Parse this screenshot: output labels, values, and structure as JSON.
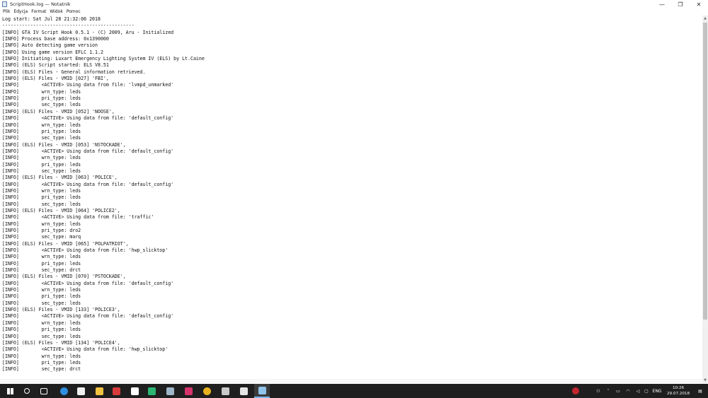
{
  "window": {
    "title": "ScriptHook.log — Notatnik",
    "minimize_glyph": "—",
    "maximize_glyph": "❐",
    "close_glyph": "✕"
  },
  "menu": [
    "Plik",
    "Edycja",
    "Format",
    "Widok",
    "Pomoc"
  ],
  "lines": [
    "Log start: Sat Jul 28 21:32:06 2018",
    "-----------------------------------------------",
    "[INFO] GTA IV Script Hook 0.5.1 - (C) 2009, Aru - Initialized",
    "[INFO] Process base address: 0x1390000",
    "[INFO] Auto detecting game version",
    "[INFO] Using game version EFLC 1.1.2",
    "[INFO] Initiating: Luxart Emergency Lighting System IV (ELS) by Lt.Caine",
    "[INFO] (ELS) Script started: ELS V8.51",
    "[INFO] (ELS) Files - General information retrieved.",
    "[INFO] (ELS) Files - VMID [027] 'FBI',",
    "[INFO]        <ACTIVE> Using data from file: 'lvmpd_unmarked'",
    "[INFO]        wrn_type: leds",
    "[INFO]        pri_type: leds",
    "[INFO]        sec_type: leds",
    "[INFO] (ELS) Files - VMID [052] 'NOOSE',",
    "[INFO]        <ACTIVE> Using data from file: 'default_config'",
    "[INFO]        wrn_type: leds",
    "[INFO]        pri_type: leds",
    "[INFO]        sec_type: leds",
    "[INFO] (ELS) Files - VMID [053] 'NSTOCKADE',",
    "[INFO]        <ACTIVE> Using data from file: 'default_config'",
    "[INFO]        wrn_type: leds",
    "[INFO]        pri_type: leds",
    "[INFO]        sec_type: leds",
    "[INFO] (ELS) Files - VMID [063] 'POLICE',",
    "[INFO]        <ACTIVE> Using data from file: 'default_config'",
    "[INFO]        wrn_type: leds",
    "[INFO]        pri_type: leds",
    "[INFO]        sec_type: leds",
    "[INFO] (ELS) Files - VMID [064] 'POLICE2',",
    "[INFO]        <ACTIVE> Using data from file: 'traffic'",
    "[INFO]        wrn_type: leds",
    "[INFO]        pri_type: dro2",
    "[INFO]        sec_type: marq",
    "[INFO] (ELS) Files - VMID [065] 'POLPATRIOT',",
    "[INFO]        <ACTIVE> Using data from file: 'hwp_slicktop'",
    "[INFO]        wrn_type: leds",
    "[INFO]        pri_type: leds",
    "[INFO]        sec_type: drct",
    "[INFO] (ELS) Files - VMID [070] 'PSTOCKADE',",
    "[INFO]        <ACTIVE> Using data from file: 'default_config'",
    "[INFO]        wrn_type: leds",
    "[INFO]        pri_type: leds",
    "[INFO]        sec_type: leds",
    "[INFO] (ELS) Files - VMID [133] 'POLICE3',",
    "[INFO]        <ACTIVE> Using data from file: 'default_config'",
    "[INFO]        wrn_type: leds",
    "[INFO]        pri_type: leds",
    "[INFO]        sec_type: leds",
    "[INFO] (ELS) Files - VMID [134] 'POLICE4',",
    "[INFO]        <ACTIVE> Using data from file: 'hwp_slicktop'",
    "[INFO]        wrn_type: leds",
    "[INFO]        pri_type: leds",
    "[INFO]        sec_type: drct"
  ],
  "taskbar": {
    "apps": [
      {
        "name": "start-button",
        "icon": "windows-logo",
        "color": "#ffffff"
      },
      {
        "name": "search-button",
        "icon": "search",
        "color": "#ffffff"
      },
      {
        "name": "task-view-button",
        "icon": "task-view",
        "color": "#ffffff"
      },
      {
        "name": "taskbar-edge",
        "icon": "edge",
        "color": "#2f8fe0"
      },
      {
        "name": "taskbar-store",
        "icon": "store",
        "color": "#f0f0f0"
      },
      {
        "name": "taskbar-explorer",
        "icon": "folder",
        "color": "#f2c343"
      },
      {
        "name": "taskbar-app-red",
        "icon": "red-app",
        "color": "#d83b3b"
      },
      {
        "name": "taskbar-app-mail",
        "icon": "mail",
        "color": "#ffffff"
      },
      {
        "name": "taskbar-app-teal",
        "icon": "teal-app",
        "color": "#2bb673"
      },
      {
        "name": "taskbar-steam",
        "icon": "steam",
        "color": "#9fb6c8"
      },
      {
        "name": "taskbar-app-pink",
        "icon": "pink-app",
        "color": "#d6336c"
      },
      {
        "name": "taskbar-chrome",
        "icon": "chrome",
        "color": "#e8b21c"
      },
      {
        "name": "taskbar-app-grey",
        "icon": "grey-app",
        "color": "#c9c9c9"
      },
      {
        "name": "taskbar-app-white",
        "icon": "white-app",
        "color": "#e5e5e5"
      },
      {
        "name": "taskbar-notepad",
        "icon": "notepad",
        "color": "#8fc3ea"
      }
    ],
    "tray_language": "ENG",
    "clock_time": "10:26",
    "clock_date": "29.07.2018"
  }
}
